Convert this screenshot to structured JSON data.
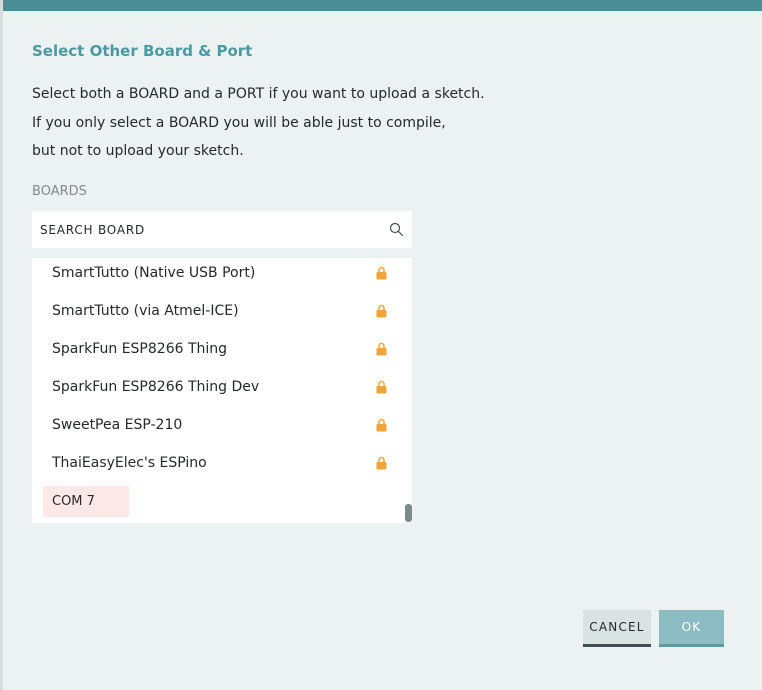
{
  "dialog": {
    "title": "Select Other Board & Port",
    "description": [
      "Select both a BOARD and a PORT if you want to upload a sketch.",
      "If you only select a BOARD you will be able just to compile,",
      "but not to upload your sketch."
    ],
    "boards_label": "BOARDS",
    "search": {
      "placeholder": "SEARCH BOARD",
      "value": ""
    },
    "boards": [
      {
        "label": "SmartTutto (Native USB Port)",
        "icon": "lock-icon"
      },
      {
        "label": "SmartTutto (via Atmel-ICE)",
        "icon": "lock-icon"
      },
      {
        "label": "SparkFun ESP8266 Thing",
        "icon": "lock-icon"
      },
      {
        "label": "SparkFun ESP8266 Thing Dev",
        "icon": "lock-icon"
      },
      {
        "label": "SweetPea ESP-210",
        "icon": "lock-icon"
      },
      {
        "label": "ThaiEasyElec's ESPino",
        "icon": "lock-icon"
      }
    ],
    "port": {
      "label": "COM 7"
    },
    "buttons": {
      "cancel": "CANCEL",
      "ok": "OK"
    }
  },
  "colors": {
    "accent": "#4a9aa3",
    "top_bar": "#4a8f96",
    "lock": "#f0a53a",
    "port_highlight": "#fde8e8",
    "ok_button": "#8bbcc2"
  }
}
